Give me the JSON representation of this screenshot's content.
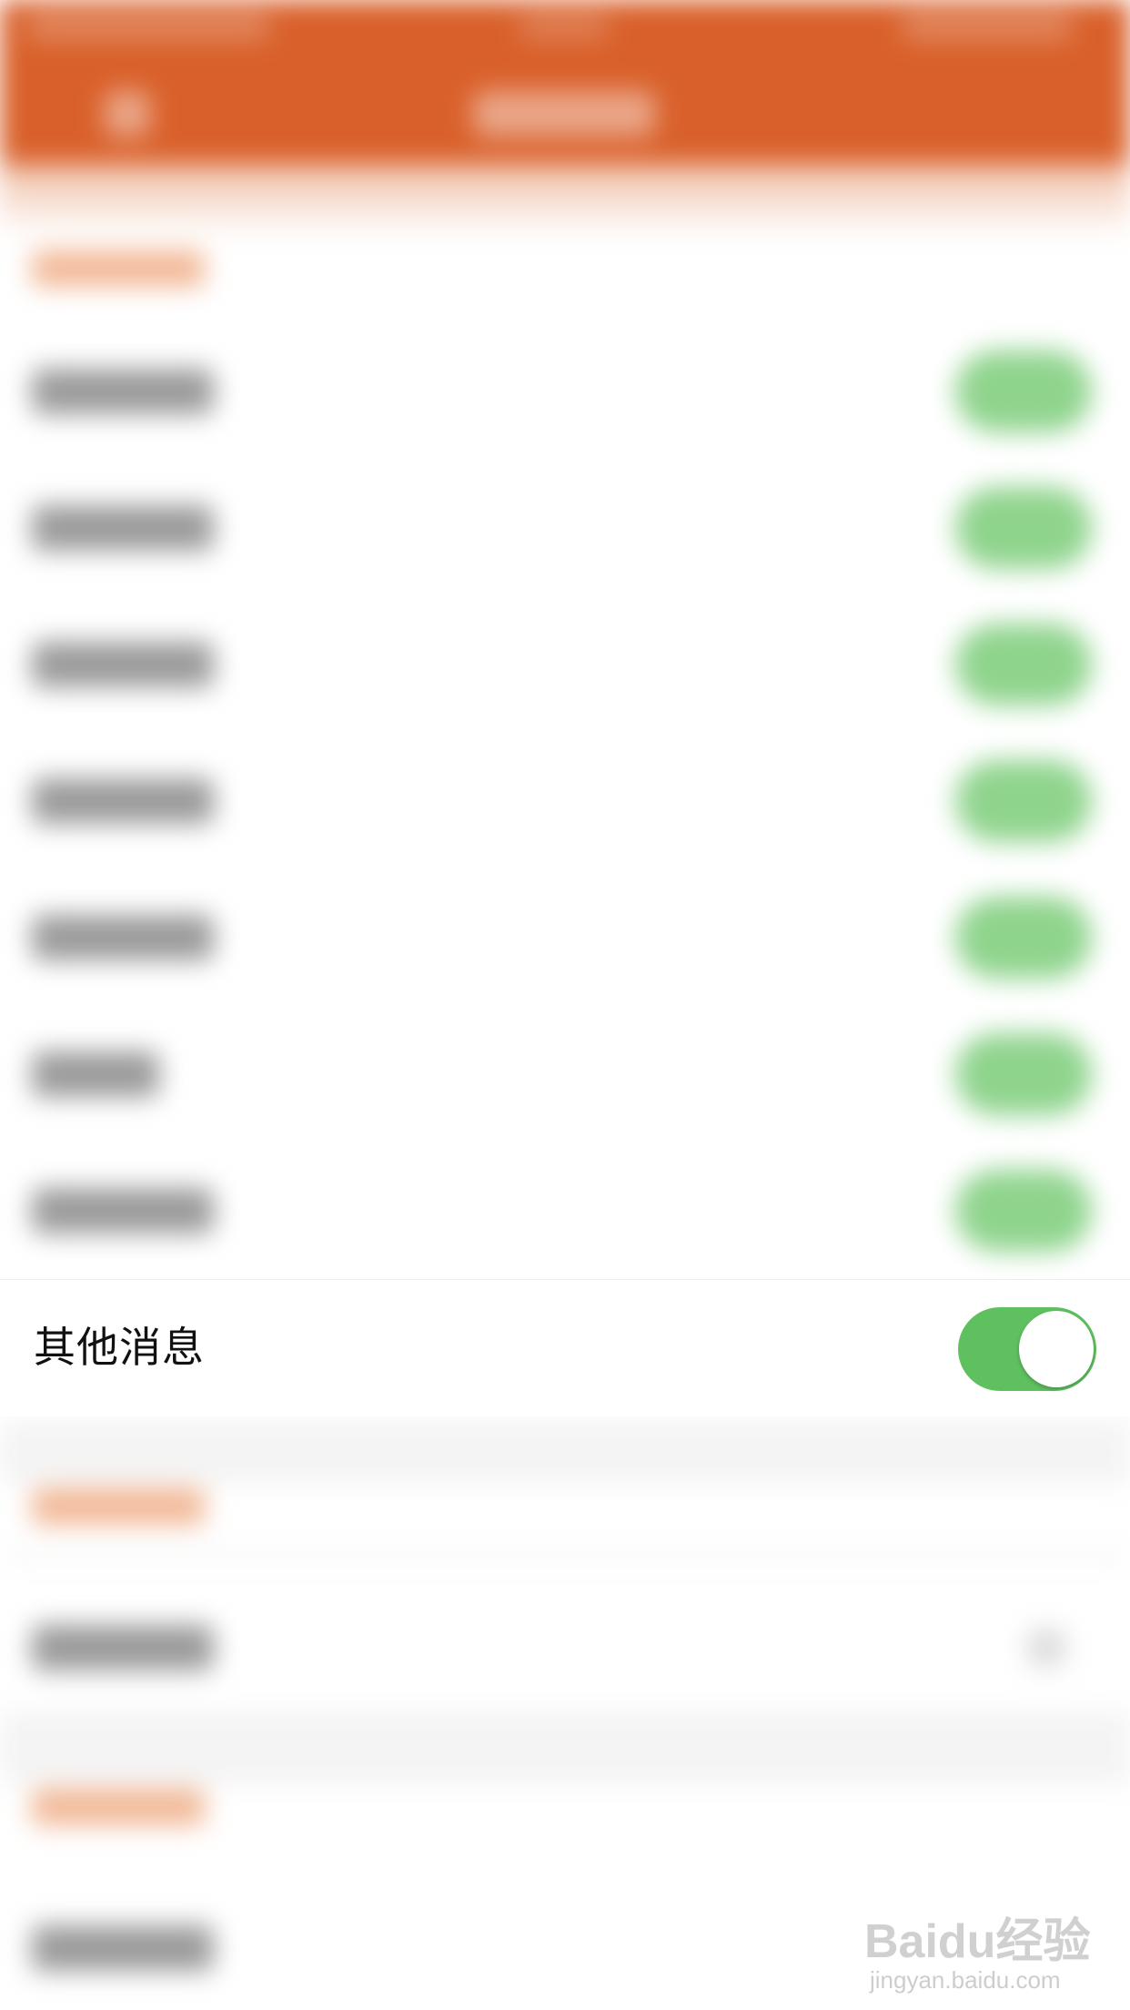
{
  "colors": {
    "header": "#d9602a",
    "toggle_on": "#5fc060",
    "section_accent": "#f2b896"
  },
  "focused_row": {
    "label": "其他消息",
    "toggle_state": "on"
  },
  "blurred_content": {
    "toggle_rows_above": 7,
    "icons": [
      "back-arrow-icon",
      "toggle-switch",
      "chevron-right-icon"
    ]
  },
  "watermark": {
    "logo": "Baidu经验",
    "url": "jingyan.baidu.com"
  }
}
